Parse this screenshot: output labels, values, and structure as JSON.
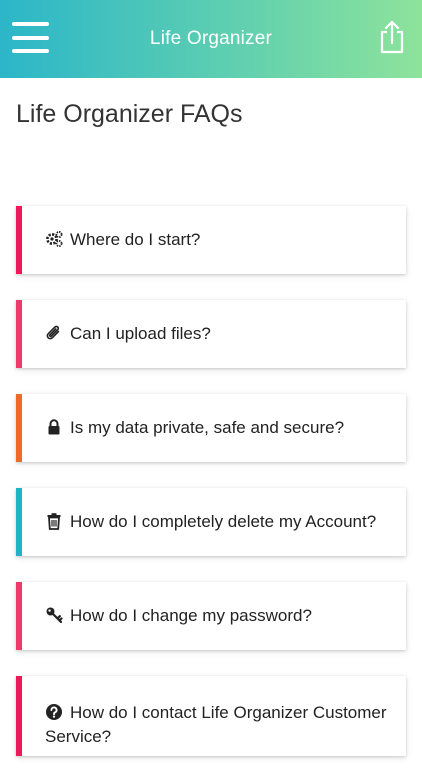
{
  "header": {
    "title": "Life Organizer"
  },
  "page": {
    "title": "Life Organizer FAQs"
  },
  "faqs": [
    {
      "question": "Where do I start?",
      "icon": "gears-icon",
      "accent": "#f2165a"
    },
    {
      "question": "Can I upload files?",
      "icon": "paperclip-icon",
      "accent": "#ec3a6a"
    },
    {
      "question": "Is my data private, safe and secure?",
      "icon": "lock-icon",
      "accent": "#ef6a25"
    },
    {
      "question": "How do I completely delete my Account?",
      "icon": "trash-icon",
      "accent": "#1fb2c9"
    },
    {
      "question": "How do I change my password?",
      "icon": "key-icon",
      "accent": "#ec3a6a"
    },
    {
      "question": "How do I contact Life Organizer Customer Service?",
      "icon": "question-circle-icon",
      "accent": "#f2165a"
    }
  ],
  "colors": {
    "header_gradient_start": "#2bb6c9",
    "header_gradient_end": "#8ee39b"
  }
}
